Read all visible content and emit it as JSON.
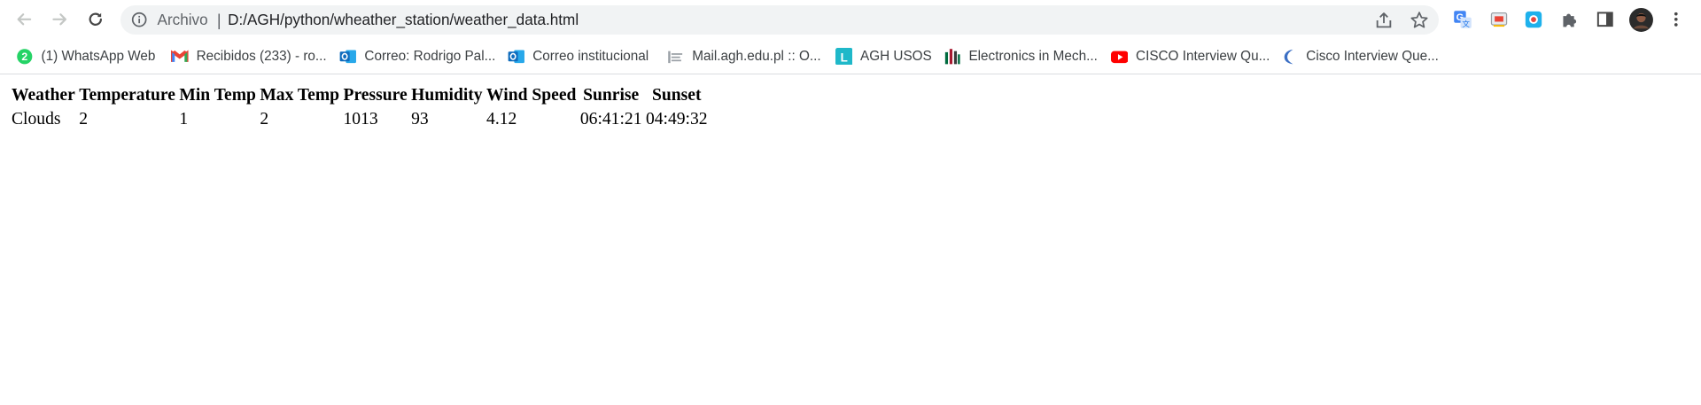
{
  "browser": {
    "address_bar": {
      "scheme_label": "Archivo",
      "separator": "|",
      "url": "D:/AGH/python/wheather_station/weather_data.html"
    },
    "icons": {
      "back": "arrow-left-icon",
      "forward": "arrow-right-icon",
      "reload": "reload-icon",
      "info": "info-icon",
      "share": "share-icon",
      "bookmark": "star-icon",
      "translate": "translate-icon",
      "cast": "cast-icon",
      "screenshot": "screenshot-icon",
      "extensions": "puzzle-icon",
      "side_panel": "side-panel-icon",
      "profile": "avatar",
      "menu": "kebab-menu-icon"
    },
    "bookmarks": [
      {
        "label": "(1) WhatsApp Web",
        "icon": "whatsapp-icon",
        "badge": "2"
      },
      {
        "label": "Recibidos (233) - ro...",
        "icon": "gmail-icon"
      },
      {
        "label": "Correo: Rodrigo Pal...",
        "icon": "outlook-icon"
      },
      {
        "label": "Correo institucional",
        "icon": "outlook-icon"
      },
      {
        "label": "Mail.agh.edu.pl :: O...",
        "icon": "mail-agh-icon"
      },
      {
        "label": "AGH USOS",
        "icon": "usos-icon",
        "icon_letter": "L"
      },
      {
        "label": "Electronics in Mech...",
        "icon": "agh-logo-icon"
      },
      {
        "label": "CISCO Interview Qu...",
        "icon": "youtube-icon"
      },
      {
        "label": "Cisco Interview Que...",
        "icon": "crescent-icon"
      }
    ]
  },
  "weather_table": {
    "headers": [
      "Weather",
      "Temperature",
      "Min Temp",
      "Max Temp",
      "Pressure",
      "Humidity",
      "Wind Speed",
      "Sunrise",
      "Sunset"
    ],
    "row": [
      "Clouds",
      "2",
      "1",
      "2",
      "1013",
      "93",
      "4.12",
      "06:41:21",
      "04:49:32"
    ]
  },
  "colors": {
    "whatsapp": "#25d366",
    "outlook": "#0f6cbd",
    "youtube": "#ff0000",
    "usos": "#1fb8c9",
    "agh_red": "#a71930",
    "agh_green": "#006b3f"
  }
}
